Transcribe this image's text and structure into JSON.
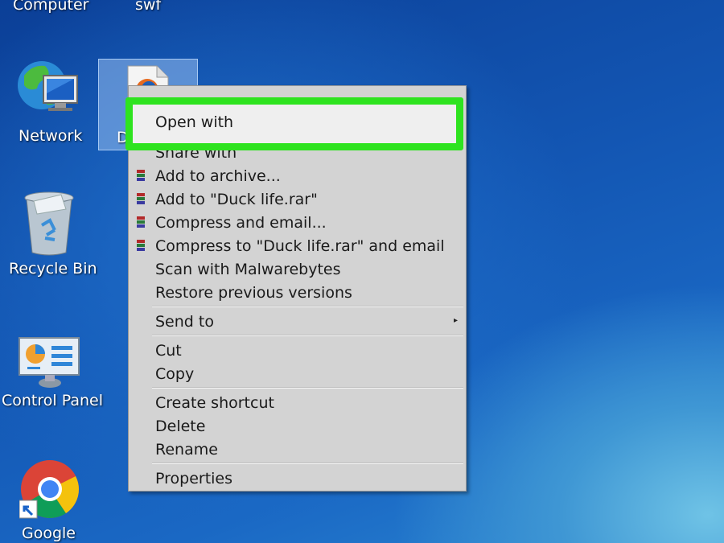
{
  "desktop": {
    "top_labels": [
      "Computer",
      "swf"
    ],
    "icons": [
      {
        "label": "Network",
        "icon": "network-icon"
      },
      {
        "label": "Recycle Bin",
        "icon": "recycle-bin-icon"
      },
      {
        "label": "Control Panel",
        "icon": "control-panel-icon"
      },
      {
        "label": "Google",
        "icon": "chrome-icon"
      }
    ],
    "selected_file_label_partial": "D"
  },
  "context_menu": {
    "highlighted_item": "Open with",
    "partial_item": "Share with",
    "archive_items": [
      "Add to archive...",
      "Add to \"Duck life.rar\"",
      "Compress and email...",
      "Compress to \"Duck life.rar\" and email"
    ],
    "group1": [
      "Scan with Malwarebytes",
      "Restore previous versions"
    ],
    "send_to": "Send to",
    "clipboard": [
      "Cut",
      "Copy"
    ],
    "edit": [
      "Create shortcut",
      "Delete",
      "Rename"
    ],
    "properties": "Properties",
    "colors": {
      "highlight_border": "#2ee31f",
      "menu_bg": "#d3d3d3",
      "winrar_icon": "#b22a2a"
    }
  }
}
